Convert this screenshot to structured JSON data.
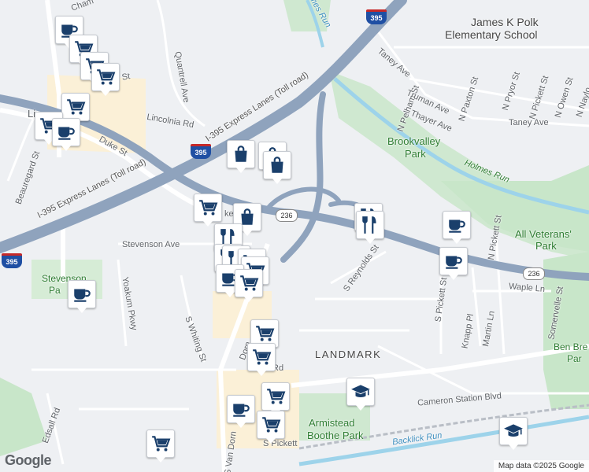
{
  "map": {
    "attribution": "Map data ©2025 Google",
    "logo": "Google",
    "labels": {
      "polk_school_line1": "James K Polk",
      "polk_school_line2": "Elementary School",
      "brookvalley_line1": "Brookvalley",
      "brookvalley_line2": "Park",
      "holmes_run_east": "Holmes Run",
      "holmes_run_north": "Holmes Run",
      "all_veterans_line1": "All Veterans'",
      "all_veterans_line2": "Park",
      "landmark": "LANDMARK",
      "armistead_line1": "Armistead",
      "armistead_line2": "Boothe Park",
      "ben_brenman_line1": "Ben Bre",
      "ben_brenman_line2": "Par",
      "stevenson_park_line1": "Stevenson",
      "stevenson_park_line2": "Pa",
      "backlick_run": "Backlick Run",
      "i395_express_1": "I-395 Express Lanes (Toll road)",
      "i395_express_2": "I-395 Express Lanes (Toll road)",
      "duke_st": "Duke St",
      "stevenson_ave": "Stevenson Ave",
      "s_reynolds_st": "S Reynolds St",
      "quantrell_ave": "Quantrell Ave",
      "lincolnia_rd": "Lincolnia Rd",
      "beauregard_st": "Beauregard St",
      "yoakum_pkwy": "Yoakum Pkwy",
      "s_whiting_st": "S Whiting St",
      "edsall_rd": "Edsall Rd",
      "s_van_dorn": "S Van Dorn",
      "s_pickett": "S Pickett",
      "s_pickett_st": "S Pickett St",
      "cameron_station_blvd": "Cameron Station Blvd",
      "taney_ave_north": "Taney Ave",
      "taney_ave_east": "Taney Ave",
      "n_pelham_st": "N Pelham St",
      "truman_ave": "Truman Ave",
      "n_paxton_st": "N Paxton St",
      "thayer_ave": "Thayer Ave",
      "n_pryor_st": "N Pryor St",
      "n_pickett_st_north": "N Pickett St",
      "n_owen_st": "N Owen St",
      "n_naylor": "N Naylo",
      "n_pickett_st": "N Pickett St",
      "waple_ln": "Waple Ln",
      "knapp_pl": "Knapp Pl",
      "martin_ln": "Martin Ln",
      "somervelle_st": "Somervelle St",
      "rd_fragment": "rd St",
      "chambliss_fragment": "Cham",
      "lincolnia_fragment": "Li",
      "rd_fragment2": "Rd",
      "dorn_fragment": "Dorn",
      "keep_fragment": "ke"
    },
    "shields": {
      "i395_top": "395",
      "i395_mid": "395",
      "i395_left": "395",
      "va236_center": "236",
      "va236_east": "236"
    },
    "colors": {
      "land": "#eef0f3",
      "park": "#c8e6c9",
      "commercial": "#fbf0d7",
      "highway": "#8fa3bd",
      "water": "#9dd3ea",
      "pin_icon": "#1a3f6b"
    }
  }
}
